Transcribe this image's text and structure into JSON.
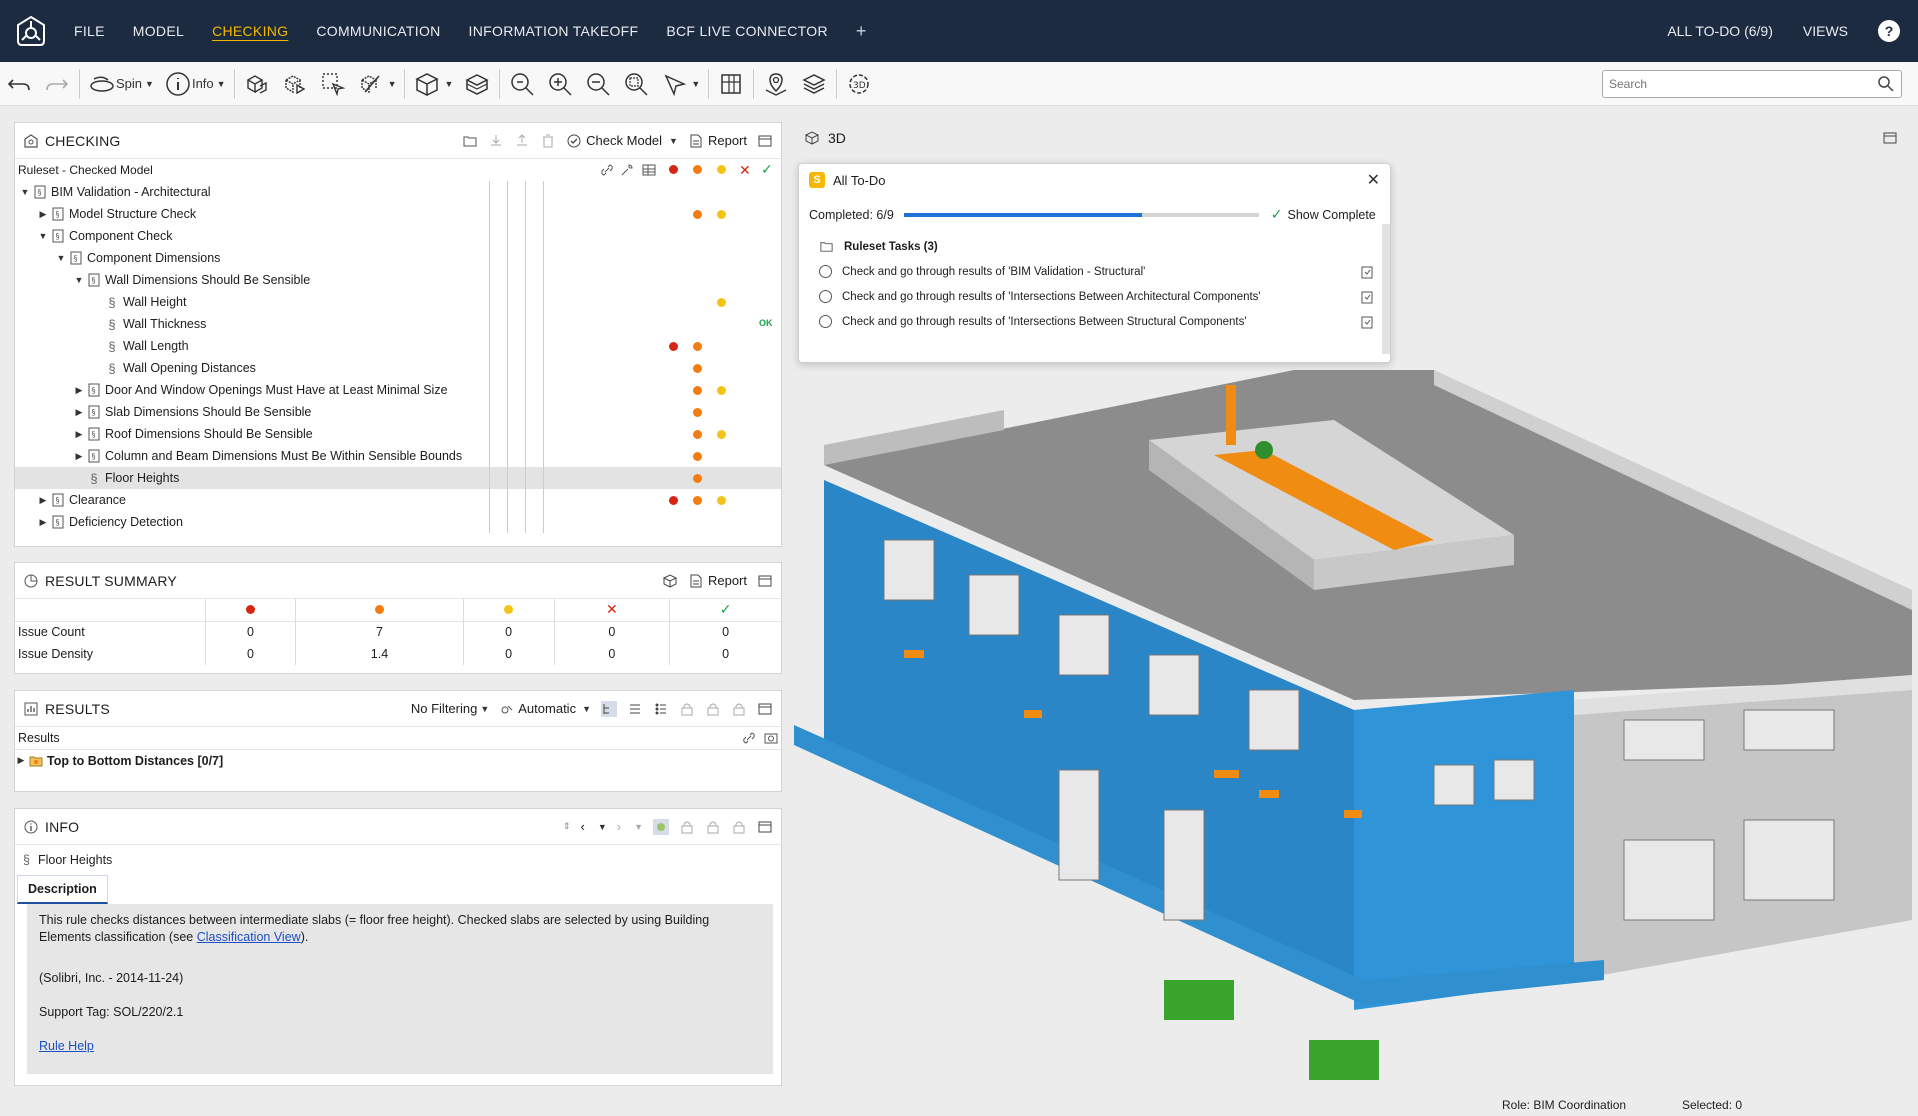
{
  "topbar": {
    "menu": [
      "FILE",
      "MODEL",
      "CHECKING",
      "COMMUNICATION",
      "INFORMATION TAKEOFF",
      "BCF LIVE CONNECTOR"
    ],
    "active": "CHECKING",
    "todo_label": "ALL TO-DO (6/9)",
    "views_label": "VIEWS",
    "help": "?"
  },
  "toolbar": {
    "spin_label": "Spin",
    "info_label": "Info",
    "search_placeholder": "Search",
    "three_d_label": "3D"
  },
  "checking": {
    "title": "CHECKING",
    "check_model_label": "Check Model",
    "report_label": "Report",
    "column_header": "Ruleset - Checked Model",
    "rows": [
      {
        "label": "BIM Validation - Architectural",
        "level": 0,
        "expand": "open",
        "kind": "ruleset",
        "dots": []
      },
      {
        "label": "Model Structure Check",
        "level": 1,
        "expand": "closed",
        "kind": "ruleset",
        "dots": [
          "orange",
          "yellow"
        ]
      },
      {
        "label": "Component Check",
        "level": 1,
        "expand": "open",
        "kind": "ruleset",
        "dots": []
      },
      {
        "label": "Component Dimensions",
        "level": 2,
        "expand": "open",
        "kind": "ruleset",
        "dots": []
      },
      {
        "label": "Wall Dimensions Should Be Sensible",
        "level": 3,
        "expand": "open",
        "kind": "ruleset",
        "dots": []
      },
      {
        "label": "Wall Height",
        "level": 4,
        "expand": "none",
        "kind": "rule",
        "dots": [
          "yellow"
        ]
      },
      {
        "label": "Wall Thickness",
        "level": 4,
        "expand": "none",
        "kind": "rule",
        "dots": [],
        "ok": "OK"
      },
      {
        "label": "Wall Length",
        "level": 4,
        "expand": "none",
        "kind": "rule",
        "dots": [
          "red",
          "orange"
        ]
      },
      {
        "label": "Wall Opening Distances",
        "level": 4,
        "expand": "none",
        "kind": "rule",
        "dots": [
          "orange"
        ]
      },
      {
        "label": "Door And Window Openings Must Have at Least Minimal Size",
        "level": 3,
        "expand": "closed",
        "kind": "ruleset",
        "dots": [
          "orange",
          "yellow"
        ]
      },
      {
        "label": "Slab Dimensions Should Be Sensible",
        "level": 3,
        "expand": "closed",
        "kind": "ruleset",
        "dots": [
          "orange"
        ]
      },
      {
        "label": "Roof Dimensions Should Be Sensible",
        "level": 3,
        "expand": "closed",
        "kind": "ruleset",
        "dots": [
          "orange",
          "yellow"
        ]
      },
      {
        "label": "Column and Beam Dimensions Must Be Within Sensible Bounds",
        "level": 3,
        "expand": "closed",
        "kind": "ruleset",
        "dots": [
          "orange"
        ]
      },
      {
        "label": "Floor Heights",
        "level": 3,
        "expand": "none",
        "kind": "rule",
        "dots": [
          "orange"
        ],
        "selected": true
      },
      {
        "label": "Clearance",
        "level": 1,
        "expand": "closed",
        "kind": "ruleset",
        "dots": [
          "red",
          "orange",
          "yellow"
        ]
      },
      {
        "label": "Deficiency Detection",
        "level": 1,
        "expand": "closed",
        "kind": "ruleset",
        "dots": []
      }
    ]
  },
  "summary": {
    "title": "RESULT SUMMARY",
    "report_label": "Report",
    "rows": [
      {
        "label": "Issue Count",
        "values": [
          "0",
          "7",
          "0",
          "0",
          "0"
        ]
      },
      {
        "label": "Issue Density",
        "values": [
          "0",
          "1.4",
          "0",
          "0",
          "0"
        ]
      }
    ]
  },
  "results": {
    "title": "RESULTS",
    "filter_label": "No Filtering",
    "mode_label": "Automatic",
    "column_header": "Results",
    "items": [
      {
        "label": "Top to Bottom Distances [0/7]"
      }
    ]
  },
  "info": {
    "title": "INFO",
    "rule_name": "Floor Heights",
    "tab": "Description",
    "desc_text": "This rule checks distances between intermediate slabs (= floor free height). Checked slabs are selected by using Building Elements classification (see ",
    "desc_link": "Classification View",
    "desc_tail": ").",
    "author": "(Solibri, Inc. - 2014-11-24)",
    "support_tag": "Support Tag: SOL/220/2.1",
    "help_link": "Rule Help"
  },
  "view3d": {
    "title": "3D"
  },
  "todo": {
    "title": "All To-Do",
    "completed_label": "Completed: 6/9",
    "progress": 0.67,
    "show_complete": "Show Complete",
    "group": "Ruleset Tasks (3)",
    "tasks": [
      "Check and go through results of 'BIM Validation - Structural'",
      "Check and go through results of 'Intersections Between Architectural Components'",
      "Check and go through results of 'Intersections Between Structural Components'"
    ]
  },
  "status": {
    "role": "Role: BIM Coordination",
    "selected": "Selected: 0"
  },
  "colors": {
    "red": "#d62612",
    "orange": "#f47d12",
    "yellow": "#f5c21a",
    "green": "#1aa34a",
    "accent": "#f5b800",
    "nav": "#1d2b40"
  }
}
